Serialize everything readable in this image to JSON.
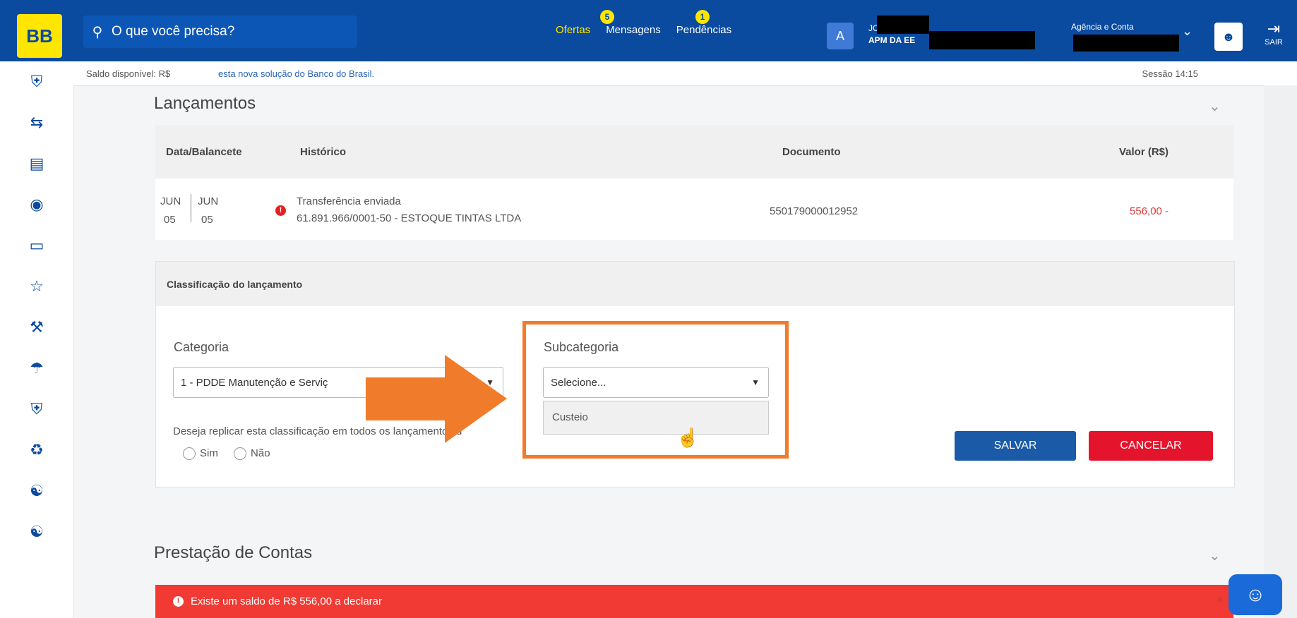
{
  "header": {
    "logo": "BB",
    "search_placeholder": "O que você precisa?",
    "nav": [
      {
        "label": "Ofertas",
        "badge": "5"
      },
      {
        "label": "Mensagens",
        "badge": "1"
      },
      {
        "label": "Pendências",
        "badge": ""
      }
    ],
    "avatar_letter": "A",
    "user_line1": "JC",
    "user_line2": "APM DA EE",
    "agencia_label": "Agência e Conta",
    "sair_label": "SAIR"
  },
  "infobar": {
    "saldo": "Saldo disponível: R$",
    "message": "esta nova solução do Banco do Brasil.",
    "session": "Sessão 14:15"
  },
  "lancamentos": {
    "title": "Lançamentos",
    "columns": [
      "Data/Balancete",
      "Histórico",
      "Documento",
      "Valor (R$)"
    ],
    "row": {
      "month1": "JUN",
      "day1": "05",
      "month2": "JUN",
      "day2": "05",
      "hist1": "Transferência enviada",
      "hist2": "61.891.966/0001-50 - ESTOQUE TINTAS LTDA",
      "documento": "550179000012952",
      "valor": "556,00 -"
    }
  },
  "classificacao": {
    "title": "Classificação do lançamento",
    "categoria_label": "Categoria",
    "categoria_value": "1 - PDDE Manutenção e Serviç",
    "subcategoria_label": "Subcategoria",
    "subcategoria_value": "Selecione...",
    "dropdown_option": "Custeio",
    "replicar_question": "Deseja replicar esta classificação em todos os lançamentos d",
    "radio_sim": "Sim",
    "radio_nao": "Não",
    "salvar": "SALVAR",
    "cancelar": "CANCELAR"
  },
  "prestacao": {
    "title": "Prestação de Contas",
    "alert": "Existe um saldo de R$ 556,00 a declarar"
  },
  "colors": {
    "brand_blue": "#0a4a9f",
    "brand_yellow": "#ffe600",
    "alert_red": "#f03a33",
    "highlight_orange": "#f07c2b"
  }
}
